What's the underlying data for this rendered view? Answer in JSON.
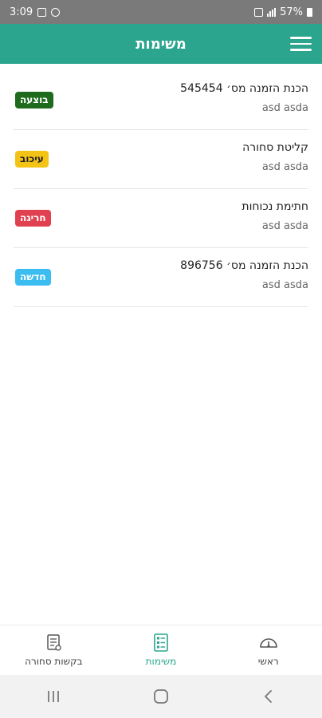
{
  "status_bar": {
    "time": "3:09",
    "battery": "57%"
  },
  "app_bar": {
    "title": "משימות"
  },
  "tasks": [
    {
      "title": "הכנת הזמנה מס׳ 545454",
      "subtitle": "asd asda",
      "status": "בוצעה",
      "badge_bg": "#1e6b1e",
      "badge_fg": "#ffffff"
    },
    {
      "title": "קליטת סחורה",
      "subtitle": "asd asda",
      "status": "עיכוב",
      "badge_bg": "#f3c316",
      "badge_fg": "#222222"
    },
    {
      "title": "חתימת נכוחות",
      "subtitle": "asd asda",
      "status": "חריגה",
      "badge_bg": "#e0404f",
      "badge_fg": "#ffffff"
    },
    {
      "title": "הכנת הזמנה מס׳ 896756",
      "subtitle": "asd asda",
      "status": "חדשה",
      "badge_bg": "#3cbdf0",
      "badge_fg": "#ffffff"
    }
  ],
  "bottom_nav": {
    "requests_label": "בקשות סחורה",
    "tasks_label": "משימות",
    "home_label": "ראשי"
  },
  "colors": {
    "accent": "#2ba58e",
    "status_bar": "#7a7a7a"
  }
}
